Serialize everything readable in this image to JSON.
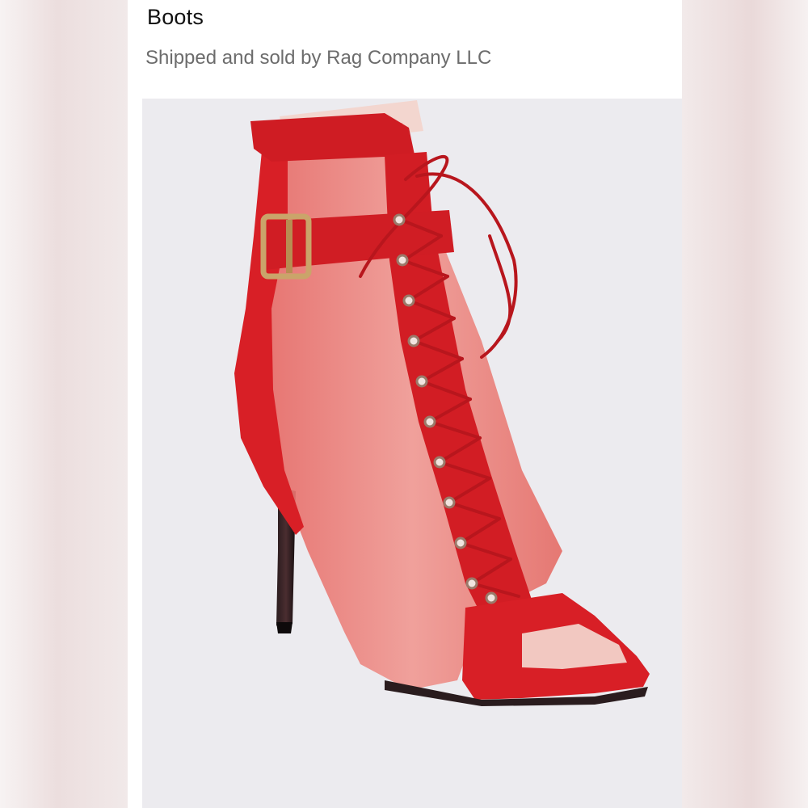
{
  "product": {
    "title": "Boots",
    "seller_line": "Shipped and sold by Rag Company LLC",
    "image_icon": "red-mesh-lace-up-peep-toe-boot-photo"
  },
  "colors": {
    "boot_red": "#d81f26",
    "mesh_red": "#e8736e",
    "heel_black": "#1a1214",
    "buckle_gold": "#caa46a",
    "photo_bg": "#ecebef"
  }
}
